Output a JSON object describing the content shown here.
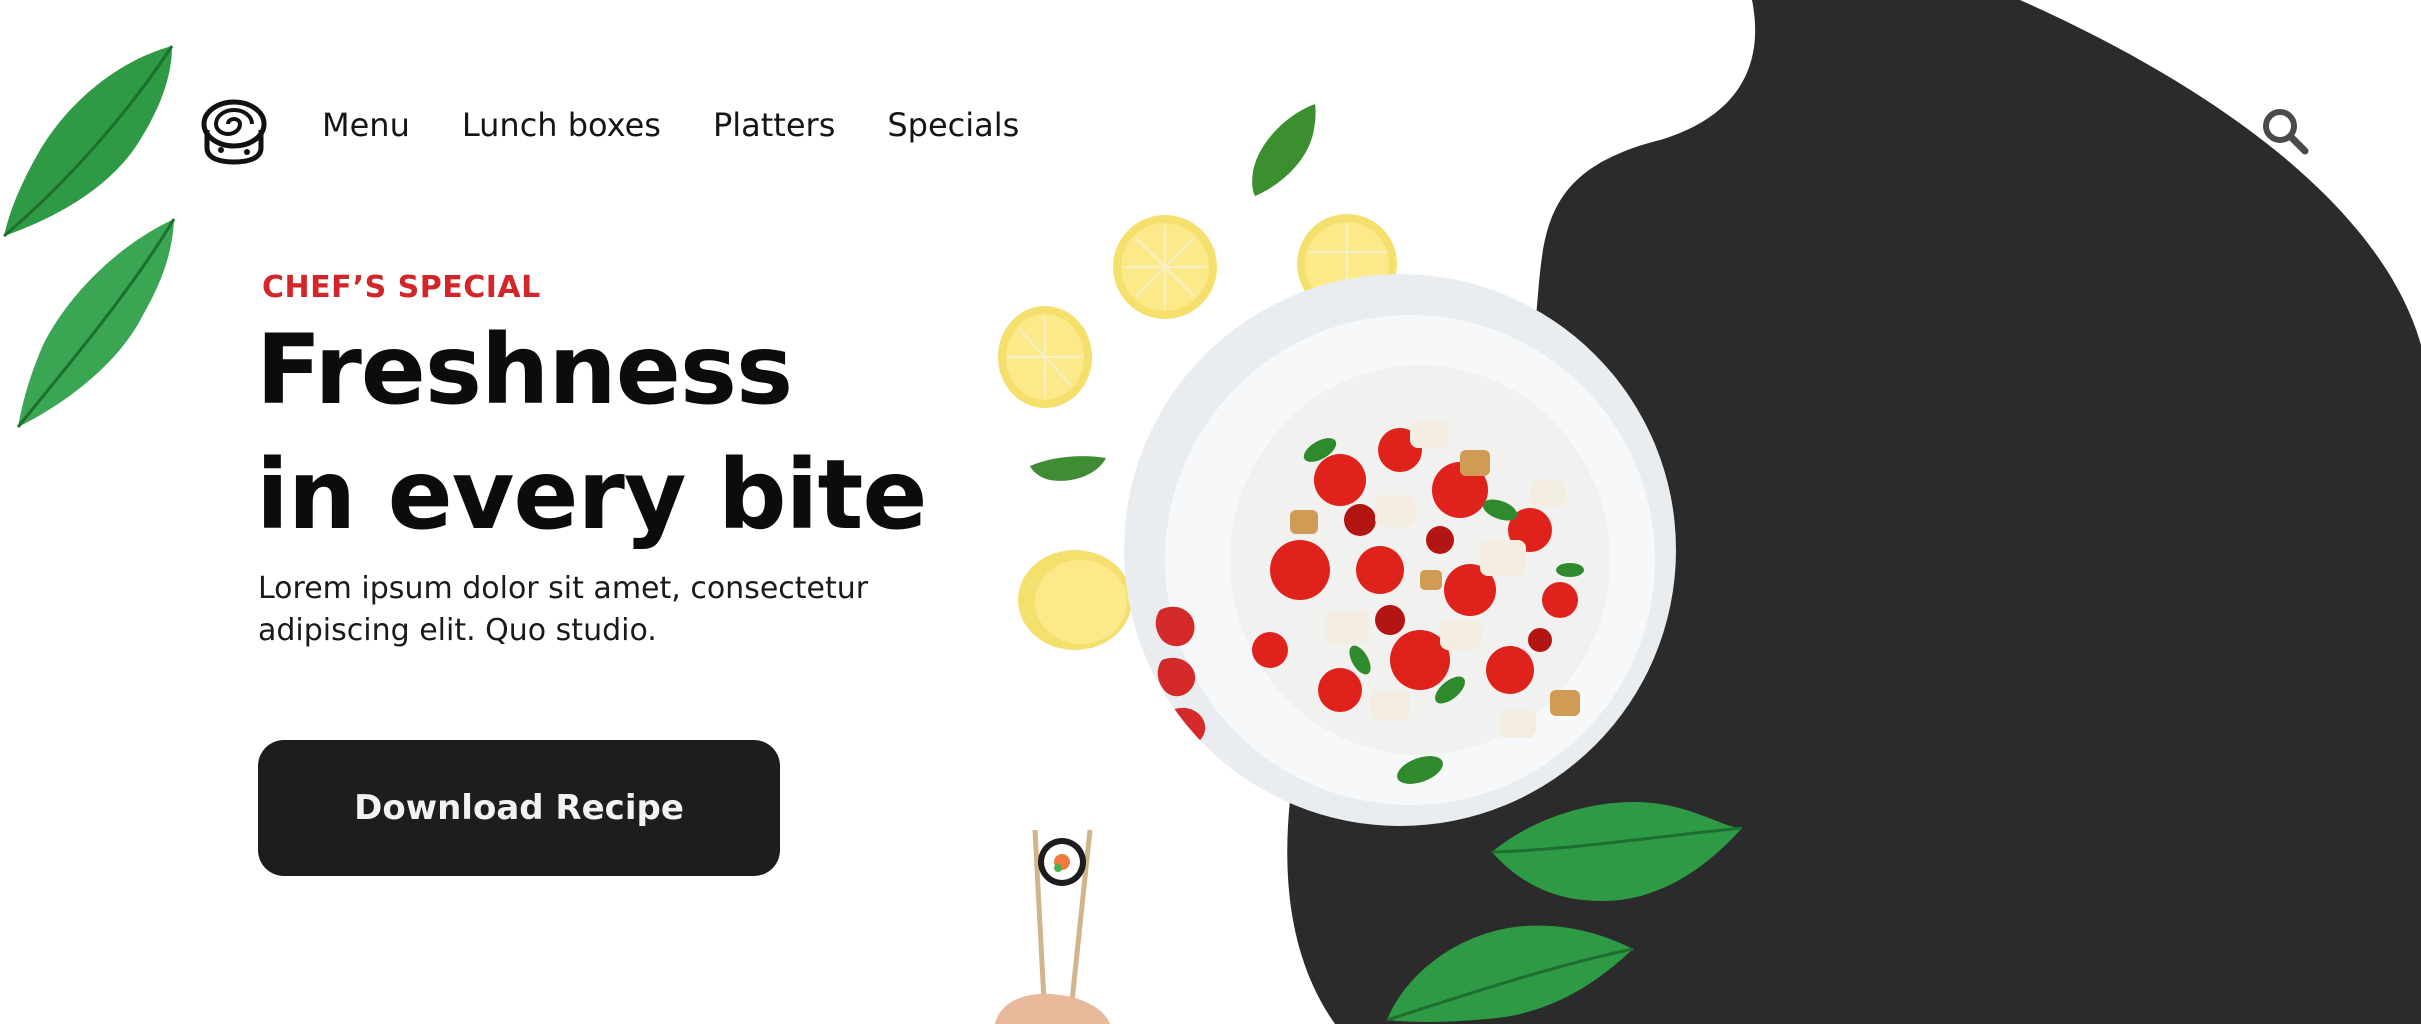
{
  "header": {
    "nav": [
      {
        "label": "Menu"
      },
      {
        "label": "Lunch boxes"
      },
      {
        "label": "Platters"
      },
      {
        "label": "Specials"
      }
    ],
    "icons": {
      "logo": "cinnamon-roll-logo-icon",
      "search": "search-icon"
    }
  },
  "hero": {
    "eyebrow": "CHEF’S SPECIAL",
    "headline_line1": "Freshness",
    "headline_line2": "in every bite",
    "description": "Lorem ipsum dolor sit amet, consectetur adipiscing elit. Quo studio.",
    "cta_label": "Download Recipe"
  },
  "colors": {
    "accent_red": "#d3262b",
    "blob_dark": "#2b2b2b",
    "button_dark": "#1e1d1e",
    "leaf_green": "#2f9a45"
  }
}
